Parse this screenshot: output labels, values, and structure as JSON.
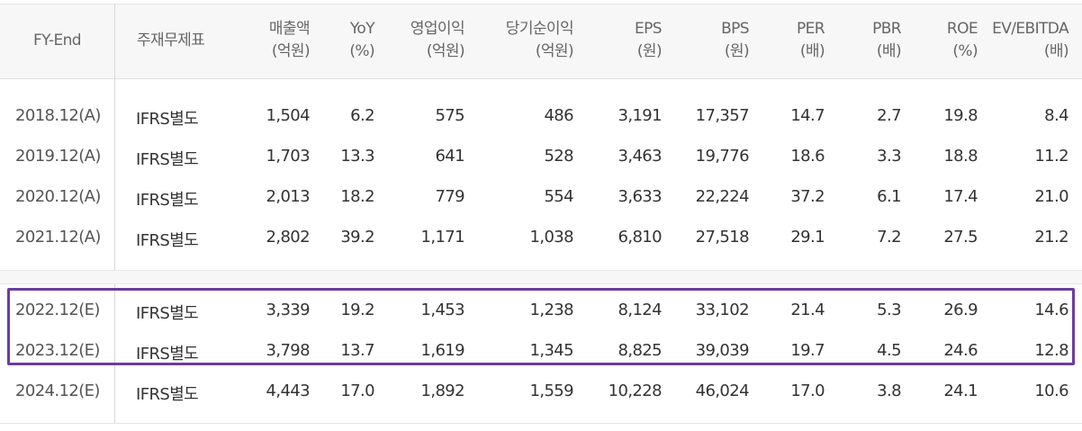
{
  "table": {
    "headers": [
      {
        "line1": "FY-End",
        "line2": ""
      },
      {
        "line1": "주재무제표",
        "line2": ""
      },
      {
        "line1": "매출액",
        "line2": "(억원)"
      },
      {
        "line1": "YoY",
        "line2": "(%)"
      },
      {
        "line1": "영업이익",
        "line2": "(억원)"
      },
      {
        "line1": "당기순이익",
        "line2": "(억원)"
      },
      {
        "line1": "EPS",
        "line2": "(원)"
      },
      {
        "line1": "BPS",
        "line2": "(원)"
      },
      {
        "line1": "PER",
        "line2": "(배)"
      },
      {
        "line1": "PBR",
        "line2": "(배)"
      },
      {
        "line1": "ROE",
        "line2": "(%)"
      },
      {
        "line1": "EV/EBITDA",
        "line2": "(배)"
      }
    ],
    "rows": [
      [
        "2018.12(A)",
        "IFRS별도",
        "1,504",
        "6.2",
        "575",
        "486",
        "3,191",
        "17,357",
        "14.7",
        "2.7",
        "19.8",
        "8.4"
      ],
      [
        "2019.12(A)",
        "IFRS별도",
        "1,703",
        "13.3",
        "641",
        "528",
        "3,463",
        "19,776",
        "18.6",
        "3.3",
        "18.8",
        "11.2"
      ],
      [
        "2020.12(A)",
        "IFRS별도",
        "2,013",
        "18.2",
        "779",
        "554",
        "3,633",
        "22,224",
        "37.2",
        "6.1",
        "17.4",
        "21.0"
      ],
      [
        "2021.12(A)",
        "IFRS별도",
        "2,802",
        "39.2",
        "1,171",
        "1,038",
        "6,810",
        "27,518",
        "29.1",
        "7.2",
        "27.5",
        "21.2"
      ],
      [
        "2022.12(E)",
        "IFRS별도",
        "3,339",
        "19.2",
        "1,453",
        "1,238",
        "8,124",
        "33,102",
        "21.4",
        "5.3",
        "26.9",
        "14.6"
      ],
      [
        "2023.12(E)",
        "IFRS별도",
        "3,798",
        "13.7",
        "1,619",
        "1,345",
        "8,825",
        "39,039",
        "19.7",
        "4.5",
        "24.6",
        "12.8"
      ],
      [
        "2024.12(E)",
        "IFRS별도",
        "4,443",
        "17.0",
        "1,892",
        "1,559",
        "10,228",
        "46,024",
        "17.0",
        "3.8",
        "24.1",
        "10.6"
      ]
    ],
    "highlight_color": "#6a3ca0"
  }
}
